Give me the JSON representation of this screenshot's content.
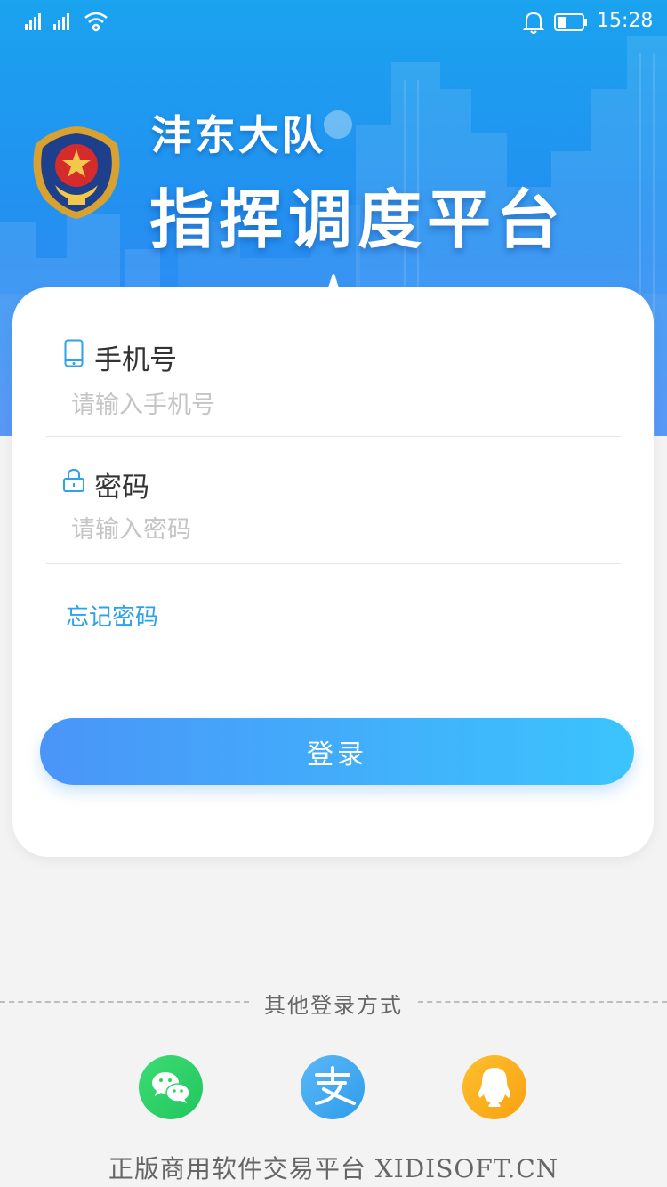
{
  "status_bar": {
    "time": "15:28"
  },
  "header": {
    "org_name": "沣东大队",
    "platform_name": "指挥调度平台",
    "emblem_icon": "fire-rescue-emblem-icon"
  },
  "form": {
    "phone": {
      "label": "手机号",
      "placeholder": "请输入手机号",
      "value": "",
      "icon": "phone-icon"
    },
    "password": {
      "label": "密码",
      "placeholder": "请输入密码",
      "value": "",
      "icon": "lock-icon"
    },
    "forgot_label": "忘记密码",
    "login_label": "登录"
  },
  "other_login": {
    "label": "其他登录方式",
    "providers": [
      {
        "name": "WeChat",
        "icon": "wechat-icon",
        "color": "#2bd36a"
      },
      {
        "name": "Alipay",
        "icon": "alipay-icon",
        "color": "#36a6f2"
      },
      {
        "name": "QQ",
        "icon": "qq-icon",
        "color": "#fbab1c"
      }
    ]
  },
  "footer": {
    "text": "正版商用软件交易平台 XIDISOFT.CN"
  },
  "colors": {
    "header_top": "#1aa3ef",
    "header_bottom": "#3a86f5",
    "accent": "#2ca3e8",
    "button_start": "#4a95f8",
    "button_end": "#3bc4fd"
  }
}
